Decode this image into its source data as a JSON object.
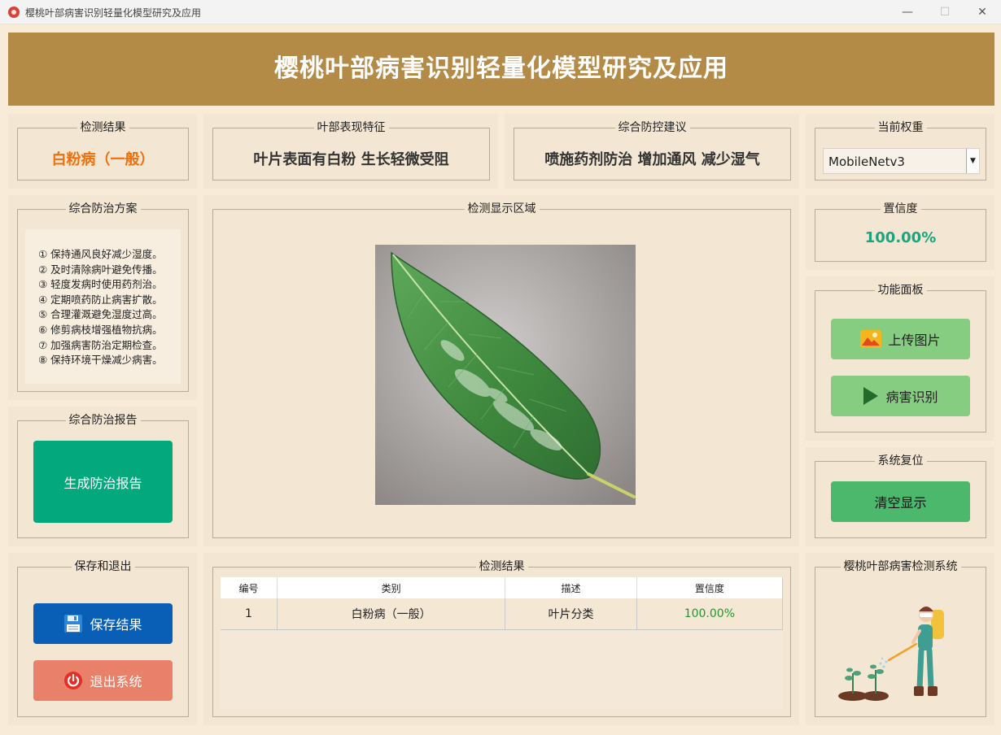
{
  "window": {
    "title": "樱桃叶部病害识别轻量化模型研究及应用",
    "minimize": "—",
    "maximize": "☐",
    "close": "✕"
  },
  "banner": {
    "title": "樱桃叶部病害识别轻量化模型研究及应用"
  },
  "detection_result": {
    "title": "检测结果",
    "value": "白粉病（一般）"
  },
  "leaf_features": {
    "title": "叶部表现特征",
    "value": "叶片表面有白粉 生长轻微受阻"
  },
  "advice": {
    "title": "综合防控建议",
    "value": "喷施药剂防治 增加通风 减少湿气"
  },
  "weights": {
    "title": "当前权重",
    "selected": "MobileNetv3",
    "arrow": "▼"
  },
  "plan": {
    "title": "综合防治方案",
    "items": [
      "① 保持通风良好减少湿度。",
      "② 及时清除病叶避免传播。",
      "③ 轻度发病时使用药剂治。",
      "④ 定期喷药防止病害扩散。",
      "⑤ 合理灌溉避免湿度过高。",
      "⑥ 修剪病枝增强植物抗病。",
      "⑦ 加强病害防治定期检查。",
      "⑧ 保持环境干燥减少病害。"
    ]
  },
  "display": {
    "title": "检测显示区域"
  },
  "confidence": {
    "title": "置信度",
    "value": "100.00%"
  },
  "functions": {
    "title": "功能面板",
    "upload": "上传图片",
    "detect": "病害识别"
  },
  "reset": {
    "title": "系统复位",
    "clear": "清空显示"
  },
  "report": {
    "title": "综合防治报告",
    "generate": "生成防治报告"
  },
  "save_exit": {
    "title": "保存和退出",
    "save": "保存结果",
    "exit": "退出系统"
  },
  "results_table": {
    "title": "检测结果",
    "headers": [
      "编号",
      "类别",
      "描述",
      "置信度"
    ],
    "rows": [
      {
        "id": "1",
        "category": "白粉病（一般）",
        "desc": "叶片分类",
        "conf": "100.00%"
      }
    ]
  },
  "system": {
    "title": "樱桃叶部病害检测系统"
  },
  "colors": {
    "banner": "#b48a47",
    "orange": "#f06f0c",
    "teal": "#03a97d",
    "blue": "#095eb6",
    "green_btn": "#86cd82",
    "exit_btn": "#e8806a"
  }
}
